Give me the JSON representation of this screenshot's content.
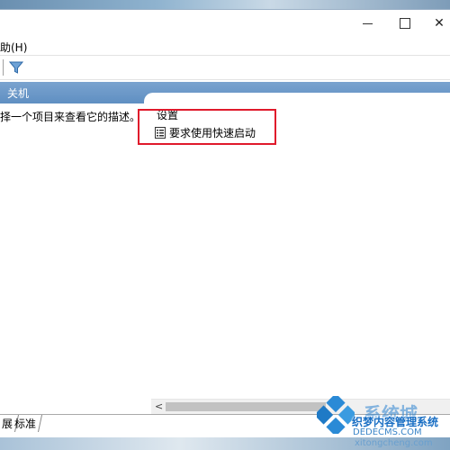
{
  "window": {
    "minimize_icon": "minimize-icon",
    "maximize_icon": "maximize-icon",
    "close_symbol": "✕"
  },
  "menu": {
    "help": "助(H)"
  },
  "toolbar": {
    "filter_icon": "filter-icon"
  },
  "header": {
    "title": "关机"
  },
  "left_pane": {
    "description": "择一个项目来查看它的描述。"
  },
  "right_pane": {
    "group_label": "设置",
    "setting_label": "要求使用快速启动",
    "setting_icon": "setting-list-icon"
  },
  "scrollbar": {
    "left_arrow": "<"
  },
  "tabs": {
    "extended": "展",
    "standard": "标准"
  },
  "watermark": {
    "big": "系统城",
    "title": "织梦内容管理系统",
    "url": "DEDECMS.COM",
    "url2": "xitongcheng.com"
  },
  "colors": {
    "header_band": "#6b97c8",
    "highlight_box": "#e0192b",
    "watermark_blue": "#1a6fc4"
  }
}
